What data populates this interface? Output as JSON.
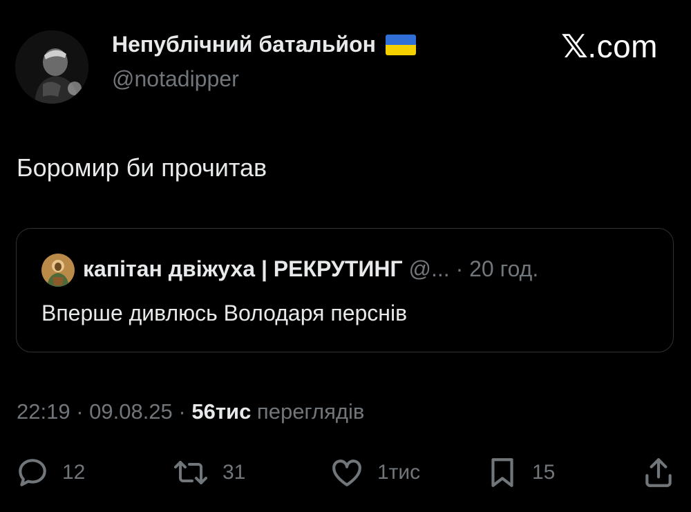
{
  "author": {
    "display_name": "Непублічний батальйон",
    "handle": "@notadipper",
    "flag_icon": "ukraine-flag-icon"
  },
  "brand": {
    "label": ".com",
    "logo_icon": "x-logo-icon"
  },
  "tweet": {
    "text": "Боромир би прочитав"
  },
  "quote": {
    "name": "капітан двіжуха | РЕКРУТИНГ",
    "handle_time": " @... · 20 год.",
    "text": "Вперше дивлюсь Володаря перснів"
  },
  "meta": {
    "time_date": "22:19 · 09.08.25 · ",
    "views_count": "56тис",
    "views_label": " переглядів"
  },
  "actions": {
    "replies": "12",
    "reposts": "31",
    "likes": "1тис",
    "bookmarks": "15"
  },
  "colors": {
    "background": "#000000",
    "text_primary": "#e7e9ea",
    "text_secondary": "#71767b",
    "border": "#2f3336"
  }
}
